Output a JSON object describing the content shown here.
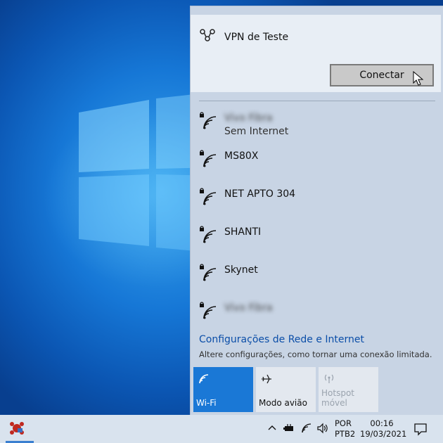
{
  "vpn": {
    "name": "VPN de Teste",
    "connect_label": "Conectar"
  },
  "networks": [
    {
      "name": "Vivo Fibra",
      "status": "Sem Internet",
      "secured": true,
      "obscured": true
    },
    {
      "name": "MS80X",
      "status": "",
      "secured": true,
      "obscured": false
    },
    {
      "name": "NET APTO 304",
      "status": "",
      "secured": true,
      "obscured": false
    },
    {
      "name": "SHANTI",
      "status": "",
      "secured": true,
      "obscured": false
    },
    {
      "name": "Skynet",
      "status": "",
      "secured": true,
      "obscured": false
    },
    {
      "name": "Vivo Fibra",
      "status": "",
      "secured": true,
      "obscured": true
    }
  ],
  "settings": {
    "link": "Configurações de Rede e Internet",
    "description": "Altere configurações, como tornar uma conexão limitada."
  },
  "quick_actions": [
    {
      "label": "Wi-Fi",
      "icon": "wifi-icon",
      "state": "on"
    },
    {
      "label": "Modo avião",
      "icon": "airplane-icon",
      "state": "off"
    },
    {
      "label": "Hotspot móvel",
      "icon": "hotspot-icon",
      "state": "disabled"
    }
  ],
  "taskbar": {
    "lang_line1": "POR",
    "lang_line2": "PTB2",
    "time": "00:16",
    "date": "19/03/2021"
  },
  "colors": {
    "accent": "#1a78d6",
    "link": "#0b4ea8",
    "flyout_bg": "#c8d4e4",
    "taskbar_bg": "#d9e3ee"
  }
}
